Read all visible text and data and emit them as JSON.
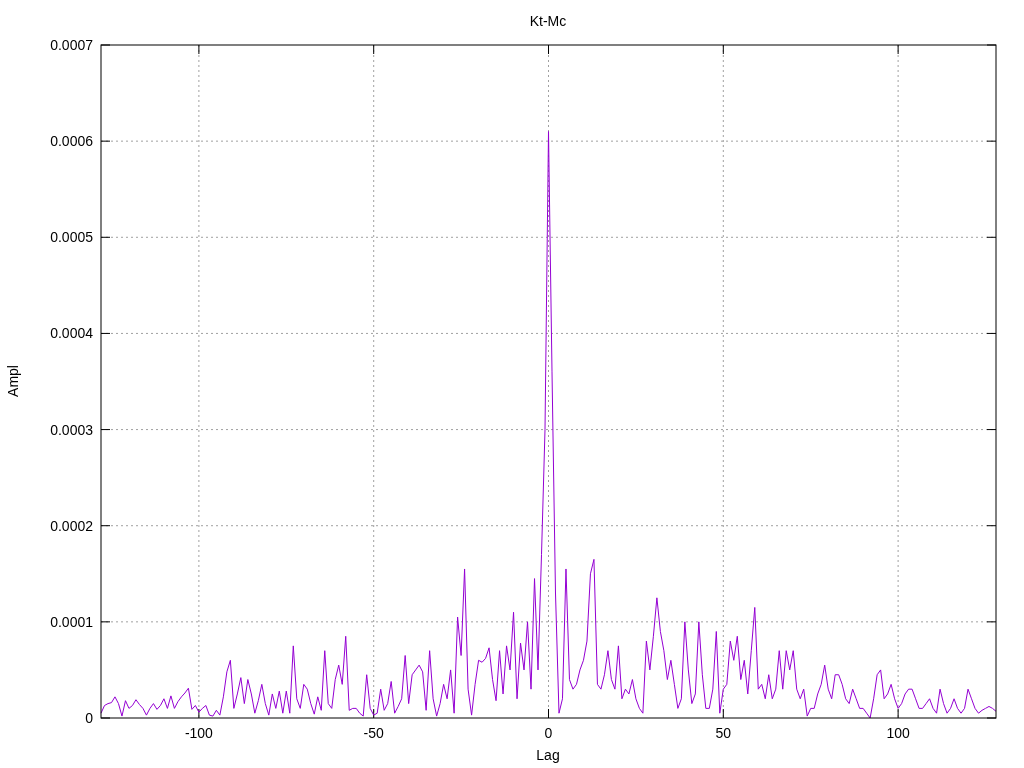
{
  "chart_data": {
    "type": "line",
    "title": "Kt-Mc",
    "xlabel": "Lag",
    "ylabel": "Ampl",
    "grid": true,
    "xlim": [
      -128,
      128
    ],
    "ylim": [
      0,
      0.0007
    ],
    "xticks": [
      -100,
      -50,
      0,
      50,
      100
    ],
    "yticks": [
      0,
      0.0001,
      0.0002,
      0.0003,
      0.0004,
      0.0005,
      0.0006,
      0.0007
    ],
    "x": [
      -128,
      -127,
      -126,
      -125,
      -124,
      -123,
      -122,
      -121,
      -120,
      -119,
      -118,
      -117,
      -116,
      -115,
      -114,
      -113,
      -112,
      -111,
      -110,
      -109,
      -108,
      -107,
      -106,
      -105,
      -104,
      -103,
      -102,
      -101,
      -100,
      -99,
      -98,
      -97,
      -96,
      -95,
      -94,
      -93,
      -92,
      -91,
      -90,
      -89,
      -88,
      -87,
      -86,
      -85,
      -84,
      -83,
      -82,
      -81,
      -80,
      -79,
      -78,
      -77,
      -76,
      -75,
      -74,
      -73,
      -72,
      -71,
      -70,
      -69,
      -68,
      -67,
      -66,
      -65,
      -64,
      -63,
      -62,
      -61,
      -60,
      -59,
      -58,
      -57,
      -56,
      -55,
      -54,
      -53,
      -52,
      -51,
      -50,
      -49,
      -48,
      -47,
      -46,
      -45,
      -44,
      -43,
      -42,
      -41,
      -40,
      -39,
      -38,
      -37,
      -36,
      -35,
      -34,
      -33,
      -32,
      -31,
      -30,
      -29,
      -28,
      -27,
      -26,
      -25,
      -24,
      -23,
      -22,
      -21,
      -20,
      -19,
      -18,
      -17,
      -16,
      -15,
      -14,
      -13,
      -12,
      -11,
      -10,
      -9,
      -8,
      -7,
      -6,
      -5,
      -4,
      -3,
      -2,
      -1,
      0,
      1,
      2,
      3,
      4,
      5,
      6,
      7,
      8,
      9,
      10,
      11,
      12,
      13,
      14,
      15,
      16,
      17,
      18,
      19,
      20,
      21,
      22,
      23,
      24,
      25,
      26,
      27,
      28,
      29,
      30,
      31,
      32,
      33,
      34,
      35,
      36,
      37,
      38,
      39,
      40,
      41,
      42,
      43,
      44,
      45,
      46,
      47,
      48,
      49,
      50,
      51,
      52,
      53,
      54,
      55,
      56,
      57,
      58,
      59,
      60,
      61,
      62,
      63,
      64,
      65,
      66,
      67,
      68,
      69,
      70,
      71,
      72,
      73,
      74,
      75,
      76,
      77,
      78,
      79,
      80,
      81,
      82,
      83,
      84,
      85,
      86,
      87,
      88,
      89,
      90,
      91,
      92,
      93,
      94,
      95,
      96,
      97,
      98,
      99,
      100,
      101,
      102,
      103,
      104,
      105,
      106,
      107,
      108,
      109,
      110,
      111,
      112,
      113,
      114,
      115,
      116,
      117,
      118,
      119,
      120,
      121,
      122,
      123,
      124,
      125,
      126,
      127,
      128
    ],
    "values": [
      5e-06,
      1.3e-05,
      1.5e-05,
      1.6e-05,
      2.2e-05,
      1.5e-05,
      2e-06,
      1.8e-05,
      1e-05,
      1.3e-05,
      1.9e-05,
      1.4e-05,
      1e-05,
      3e-06,
      1e-05,
      1.5e-05,
      9e-06,
      1.3e-05,
      2e-05,
      1e-05,
      2.3e-05,
      1e-05,
      1.7e-05,
      2.2e-05,
      2.6e-05,
      3.1e-05,
      9e-06,
      1.3e-05,
      6e-06,
      1e-05,
      1.3e-05,
      3e-06,
      2e-06,
      8e-06,
      3e-06,
      2.2e-05,
      4.8e-05,
      6e-05,
      1e-05,
      2.5e-05,
      4.2e-05,
      1.5e-05,
      4e-05,
      2.5e-05,
      5e-06,
      1.8e-05,
      3.5e-05,
      1.5e-05,
      3e-06,
      2.5e-05,
      1e-05,
      2.8e-05,
      5e-06,
      2.8e-05,
      5e-06,
      7.5e-05,
      2e-05,
      1e-05,
      3.5e-05,
      3e-05,
      1.5e-05,
      4e-06,
      2.2e-05,
      8e-06,
      7e-05,
      1.5e-05,
      1e-05,
      4e-05,
      5.5e-05,
      3.5e-05,
      8.5e-05,
      8e-06,
      1e-05,
      1e-05,
      5e-06,
      2e-06,
      4.5e-05,
      1e-05,
      3e-06,
      5e-06,
      3e-05,
      8e-06,
      1.5e-05,
      3.8e-05,
      5e-06,
      1.2e-05,
      2e-05,
      6.5e-05,
      1.5e-05,
      4.5e-05,
      5e-05,
      5.5e-05,
      4.8e-05,
      8e-06,
      7e-05,
      2e-05,
      2e-06,
      1.5e-05,
      3.5e-05,
      2e-05,
      5e-05,
      5e-06,
      0.000105,
      6.5e-05,
      0.000155,
      3e-05,
      3e-06,
      3.5e-05,
      6e-05,
      5.8e-05,
      6.2e-05,
      7.3e-05,
      4e-05,
      1.8e-05,
      7e-05,
      2.5e-05,
      7.5e-05,
      5e-05,
      0.00011,
      2e-05,
      7.8e-05,
      5e-05,
      0.0001,
      3e-05,
      0.000145,
      5e-05,
      0.00017,
      0.0003,
      0.00061,
      0.00036,
      0.00013,
      5e-06,
      2e-05,
      0.000155,
      4e-05,
      3e-05,
      3.5e-05,
      5e-05,
      6e-05,
      8e-05,
      0.00015,
      0.000165,
      3.5e-05,
      3e-05,
      4.5e-05,
      7e-05,
      4e-05,
      3e-05,
      7.5e-05,
      2e-05,
      3e-05,
      2.5e-05,
      4e-05,
      2e-05,
      1e-05,
      5e-06,
      8e-05,
      5e-05,
      8.5e-05,
      0.000125,
      9e-05,
      7e-05,
      4e-05,
      6e-05,
      3.5e-05,
      1e-05,
      2e-05,
      0.0001,
      5e-05,
      1.5e-05,
      2.5e-05,
      0.0001,
      4.5e-05,
      1e-05,
      1e-05,
      3e-05,
      9e-05,
      5e-06,
      3e-05,
      3.5e-05,
      8e-05,
      6e-05,
      8.5e-05,
      4e-05,
      6e-05,
      2.5e-05,
      7e-05,
      0.000115,
      3e-05,
      3.5e-05,
      2e-05,
      4.5e-05,
      2e-05,
      3e-05,
      7e-05,
      3e-05,
      7e-05,
      5e-05,
      7e-05,
      3e-05,
      2e-05,
      3e-05,
      2e-06,
      1e-05,
      1e-05,
      2.5e-05,
      3.5e-05,
      5.5e-05,
      3e-05,
      2e-05,
      4.5e-05,
      4.5e-05,
      3.5e-05,
      2e-05,
      1.5e-05,
      3e-05,
      2e-05,
      1e-05,
      1e-05,
      5e-06,
      0,
      2e-05,
      4.5e-05,
      5e-05,
      2e-05,
      2.5e-05,
      3.5e-05,
      2e-05,
      1e-05,
      1.5e-05,
      2.5e-05,
      3e-05,
      3e-05,
      2e-05,
      1e-05,
      1e-05,
      1.5e-05,
      2e-05,
      1e-05,
      5e-06,
      3e-05,
      1.5e-05,
      5e-06,
      1e-05,
      2e-05,
      1e-05,
      5e-06,
      1e-05,
      3e-05,
      2e-05,
      1e-05,
      5e-06,
      8e-06,
      1e-05,
      1.2e-05,
      1e-05,
      7e-06
    ]
  }
}
